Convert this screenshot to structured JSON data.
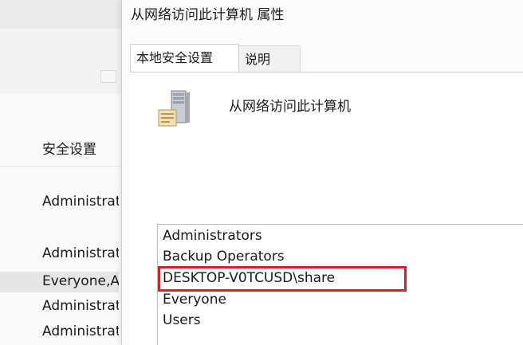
{
  "background_window": {
    "column_header": "安全设置",
    "rows": [
      "Administrators",
      "Administrators",
      "Everyone,Administrators",
      "Administrators",
      "Administrators"
    ]
  },
  "dialog": {
    "title": "从网络访问此计算机 属性",
    "tabs": [
      {
        "label": "本地安全设置",
        "active": true
      },
      {
        "label": "说明",
        "active": false
      }
    ],
    "policy_icon": "server-policy-icon",
    "policy_name": "从网络访问此计算机",
    "members": [
      "Administrators",
      "Backup Operators",
      "DESKTOP-V0TCUSD\\share",
      "Everyone",
      "Users"
    ],
    "highlighted_member": "DESKTOP-V0TCUSD\\share",
    "highlight_color": "#d2232a"
  }
}
